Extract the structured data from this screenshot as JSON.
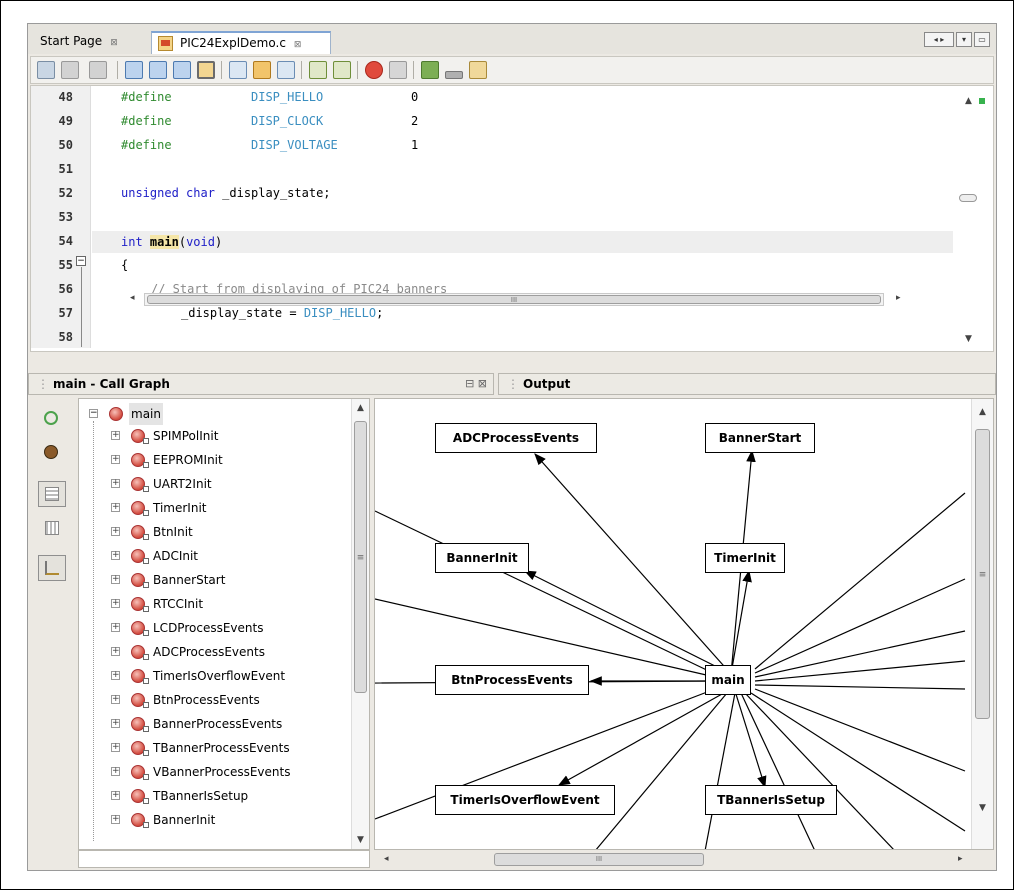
{
  "tabs": [
    {
      "label": "Start Page",
      "close": "⊠"
    },
    {
      "label": "PIC24ExplDemo.c",
      "close": "⊠"
    }
  ],
  "window_controls": [
    "◂ ▸",
    "▾",
    "▭"
  ],
  "editor": {
    "lines": [
      {
        "num": "48"
      },
      {
        "num": "49"
      },
      {
        "num": "50"
      },
      {
        "num": "51"
      },
      {
        "num": "52"
      },
      {
        "num": "53"
      },
      {
        "num": "54"
      },
      {
        "num": "55"
      },
      {
        "num": "56"
      },
      {
        "num": "57"
      },
      {
        "num": "58"
      }
    ],
    "code": {
      "l48_kw": "#define",
      "l48_macro": "DISP_HELLO",
      "l48_val": "0",
      "l49_kw": "#define",
      "l49_macro": "DISP_CLOCK",
      "l49_val": "2",
      "l50_kw": "#define",
      "l50_macro": "DISP_VOLTAGE",
      "l50_val": "1",
      "l52_type": "unsigned char",
      "l52_rest": " _display_state;",
      "l54_type": "int",
      "l54_fn": "main",
      "l54_paren_open": "(",
      "l54_void": "void",
      "l54_paren_close": ")",
      "l55_brace": "{",
      "l56_comment": "// Start from displaying of PIC24 banners",
      "l57_lhs": "_display_state = ",
      "l57_macro": "DISP_HELLO",
      "l57_semi": ";"
    },
    "hscroll_grip": "III"
  },
  "call_graph_panel": {
    "title": "main - Call Graph",
    "header_buttons": "⊟ ⊠",
    "root": "main",
    "items": [
      "SPIMPolInit",
      "EEPROMInit",
      "UART2Init",
      "TimerInit",
      "BtnInit",
      "ADCInit",
      "BannerStart",
      "RTCCInit",
      "LCDProcessEvents",
      "ADCProcessEvents",
      "TimerIsOverflowEvent",
      "BtnProcessEvents",
      "BannerProcessEvents",
      "TBannerProcessEvents",
      "VBannerProcessEvents",
      "TBannerIsSetup",
      "BannerInit"
    ],
    "scroll_grip": "≡"
  },
  "output_panel": {
    "title": "Output"
  },
  "graph": {
    "center": "main",
    "nodes": {
      "adc": "ADCProcessEvents",
      "bstart": "BannerStart",
      "binit": "BannerInit",
      "tinit": "TimerInit",
      "btnpe": "BtnProcessEvents",
      "tiov": "TimerIsOverflowEvent",
      "tbis": "TBannerIsSetup"
    },
    "scroll_grip": "III"
  },
  "colors": {
    "keyword": "#2020c8",
    "preprocessor": "#2f8a2f",
    "macro": "#3a8ec0",
    "comment": "#8a8a8a",
    "function_icon": "#d24b3e"
  }
}
